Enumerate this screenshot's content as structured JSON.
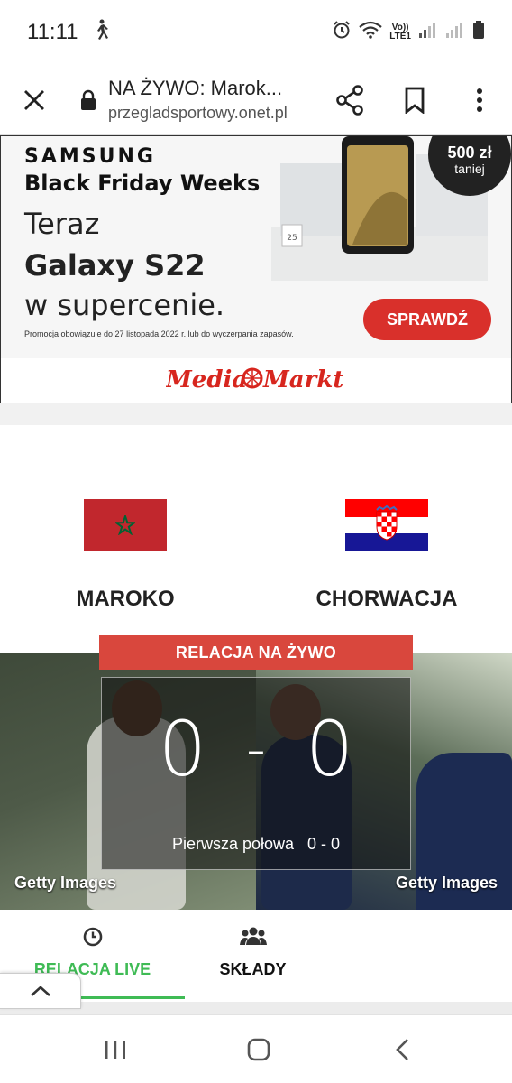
{
  "status_bar": {
    "time": "11:11",
    "lte_top": "Vo))",
    "lte_bottom": "LTE1"
  },
  "browser": {
    "page_title": "NA ŻYWO: Marok...",
    "domain": "przegladsportowy.onet.pl"
  },
  "ad": {
    "brand": "SAMSUNG",
    "headline": "Black Friday Weeks",
    "line1": "Teraz",
    "line2": "Galaxy S22",
    "line3": "w supercenie.",
    "fine_print": "Promocja obowiązuje do 27 listopada 2022 r. lub do wyczerpania zapasów.",
    "cta": "SPRAWDŹ",
    "badge_amount": "500 zł",
    "badge_text": "taniej",
    "retailer": "MediaMarkt"
  },
  "match": {
    "home_team": "MAROKO",
    "away_team": "CHORWACJA",
    "live_label": "RELACJA NA ŻYWO",
    "home_score": "0",
    "separator": "-",
    "away_score": "0",
    "half_status": "Pierwsza połowa   0 - 0",
    "photo_credit_left": "Getty Images",
    "photo_credit_right": "Getty Images"
  },
  "tabs": [
    {
      "label": "RELACJA LIVE",
      "active": true
    },
    {
      "label": "SKŁADY",
      "active": false
    }
  ],
  "colors": {
    "live_banner": "#d9473d",
    "active_tab": "#3fbb55",
    "cta": "#d9302b",
    "morocco_red": "#c1272d",
    "morocco_star": "#006233"
  }
}
